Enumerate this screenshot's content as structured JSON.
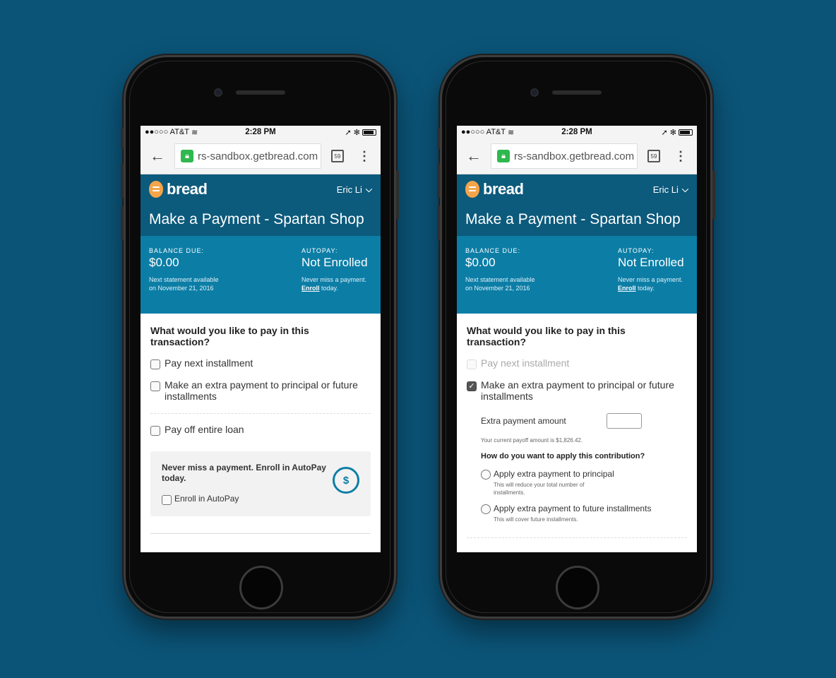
{
  "browser": {
    "carrier": "●●○○○ AT&T",
    "time": "2:28 PM",
    "status_right": "➚ ✻",
    "url": "rs-sandbox.getbread.com",
    "tab_count": "59"
  },
  "app": {
    "logo": "bread",
    "user": "Eric Li",
    "title": "Make a Payment - Spartan Shop"
  },
  "balance": {
    "label": "BALANCE DUE:",
    "value": "$0.00",
    "note": "Next statement available on November 21, 2016"
  },
  "autopay": {
    "label": "AUTOPAY:",
    "value": "Not Enrolled",
    "note_prefix": "Never miss a payment.",
    "enroll_link": "Enroll",
    "note_suffix": "today."
  },
  "form": {
    "question": "What would you like to pay in this transaction?",
    "options": {
      "next": "Pay next installment",
      "extra": "Make an extra payment to principal or future installments",
      "payoff": "Pay off entire loan"
    },
    "autopay_promo": {
      "title": "Never miss a payment. Enroll in AutoPay today.",
      "checkbox": "Enroll in AutoPay",
      "icon": "$"
    },
    "extra": {
      "amount_label": "Extra payment amount",
      "payoff_note": "Your current payoff amount is $1,826.42.",
      "apply_question": "How do you want to apply this contribution?",
      "principal": "Apply extra payment to principal",
      "principal_note": "This will reduce your total number of installments.",
      "future": "Apply extra payment to future installments",
      "future_note": "This will cover future installments."
    }
  },
  "colors": {
    "header": "#0c5a7c",
    "balance": "#0c7ea6",
    "background": "#0b5478",
    "logo": "#f5a44a"
  }
}
